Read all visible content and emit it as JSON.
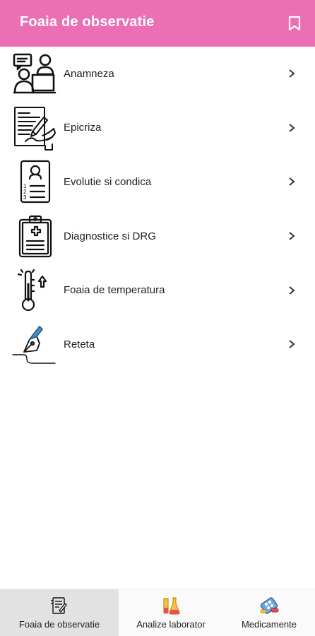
{
  "header": {
    "title": "Foaia de observatie",
    "bookmark_icon": "bookmark-icon",
    "color": "#ec6eb4"
  },
  "menu": {
    "items": [
      {
        "label": "Anamneza",
        "icon": "doctor-patient-consult-icon"
      },
      {
        "label": "Epicriza",
        "icon": "document-sign-icon"
      },
      {
        "label": "Evolutie si condica",
        "icon": "numbered-checklist-icon"
      },
      {
        "label": "Diagnostice si DRG",
        "icon": "medical-clipboard-icon"
      },
      {
        "label": "Foaia de temperatura",
        "icon": "thermometer-icon"
      },
      {
        "label": "Reteta",
        "icon": "fountain-pen-icon"
      }
    ],
    "chevron_icon": "chevron-right-icon"
  },
  "bottom_nav": {
    "tabs": [
      {
        "label": "Foaia de observatie",
        "icon": "observation-sheet-icon",
        "active": true
      },
      {
        "label": "Analize laborator",
        "icon": "lab-flasks-icon",
        "active": false
      },
      {
        "label": "Medicamente",
        "icon": "medicine-pills-icon",
        "active": false
      }
    ],
    "active_color": "#e2e2e2"
  }
}
